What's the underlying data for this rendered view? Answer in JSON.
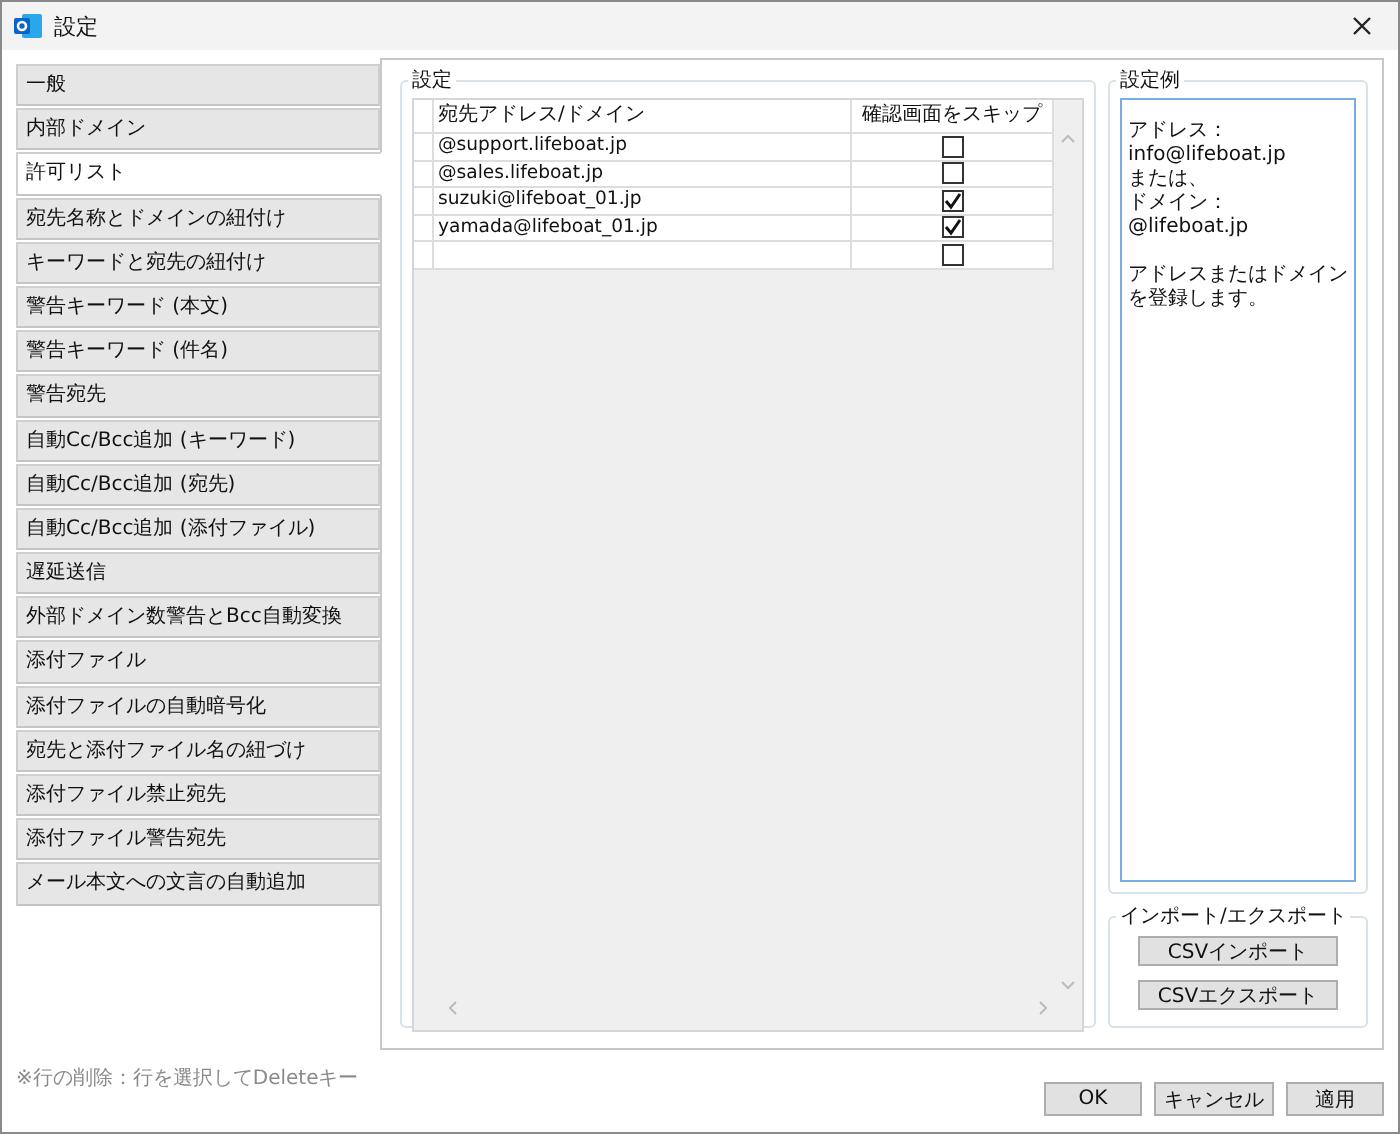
{
  "window": {
    "title": "設定"
  },
  "sidebar": {
    "items": [
      {
        "label": "一般",
        "selected": false
      },
      {
        "label": "内部ドメイン",
        "selected": false
      },
      {
        "label": "許可リスト",
        "selected": true
      },
      {
        "label": "宛先名称とドメインの紐付け",
        "selected": false
      },
      {
        "label": "キーワードと宛先の紐付け",
        "selected": false
      },
      {
        "label": "警告キーワード (本文)",
        "selected": false
      },
      {
        "label": "警告キーワード (件名)",
        "selected": false
      },
      {
        "label": "警告宛先",
        "selected": false
      },
      {
        "label": "自動Cc/Bcc追加 (キーワード)",
        "selected": false
      },
      {
        "label": "自動Cc/Bcc追加 (宛先)",
        "selected": false
      },
      {
        "label": "自動Cc/Bcc追加 (添付ファイル)",
        "selected": false
      },
      {
        "label": "遅延送信",
        "selected": false
      },
      {
        "label": "外部ドメイン数警告とBcc自動変換",
        "selected": false
      },
      {
        "label": "添付ファイル",
        "selected": false
      },
      {
        "label": "添付ファイルの自動暗号化",
        "selected": false
      },
      {
        "label": "宛先と添付ファイル名の紐づけ",
        "selected": false
      },
      {
        "label": "添付ファイル禁止宛先",
        "selected": false
      },
      {
        "label": "添付ファイル警告宛先",
        "selected": false
      },
      {
        "label": "メール本文への文言の自動追加",
        "selected": false
      }
    ]
  },
  "settings": {
    "title": "設定",
    "columns": [
      "宛先アドレス/ドメイン",
      "確認画面をスキップ"
    ],
    "rows": [
      {
        "address": "@support.lifeboat.jp",
        "skip": false
      },
      {
        "address": "@sales.lifeboat.jp",
        "skip": false
      },
      {
        "address": "suzuki@lifeboat_01.jp",
        "skip": true
      },
      {
        "address": "yamada@lifeboat_01.jp",
        "skip": true
      },
      {
        "skip": false
      }
    ]
  },
  "example": {
    "title": "設定例",
    "paragraphs": [
      [
        "アドレス：info@lifeboat.jp",
        "または、",
        "ドメイン：@lifeboat.jp"
      ],
      [
        "アドレスまたはドメインを登録します。"
      ]
    ]
  },
  "import_export": {
    "title": "インポート/エクスポート",
    "buttons": [
      "CSVインポート",
      "CSVエクスポート"
    ]
  },
  "note": "※行の削除：行を選択してDeleteキー",
  "buttons": [
    "OK",
    "キャンセル",
    "適用"
  ]
}
